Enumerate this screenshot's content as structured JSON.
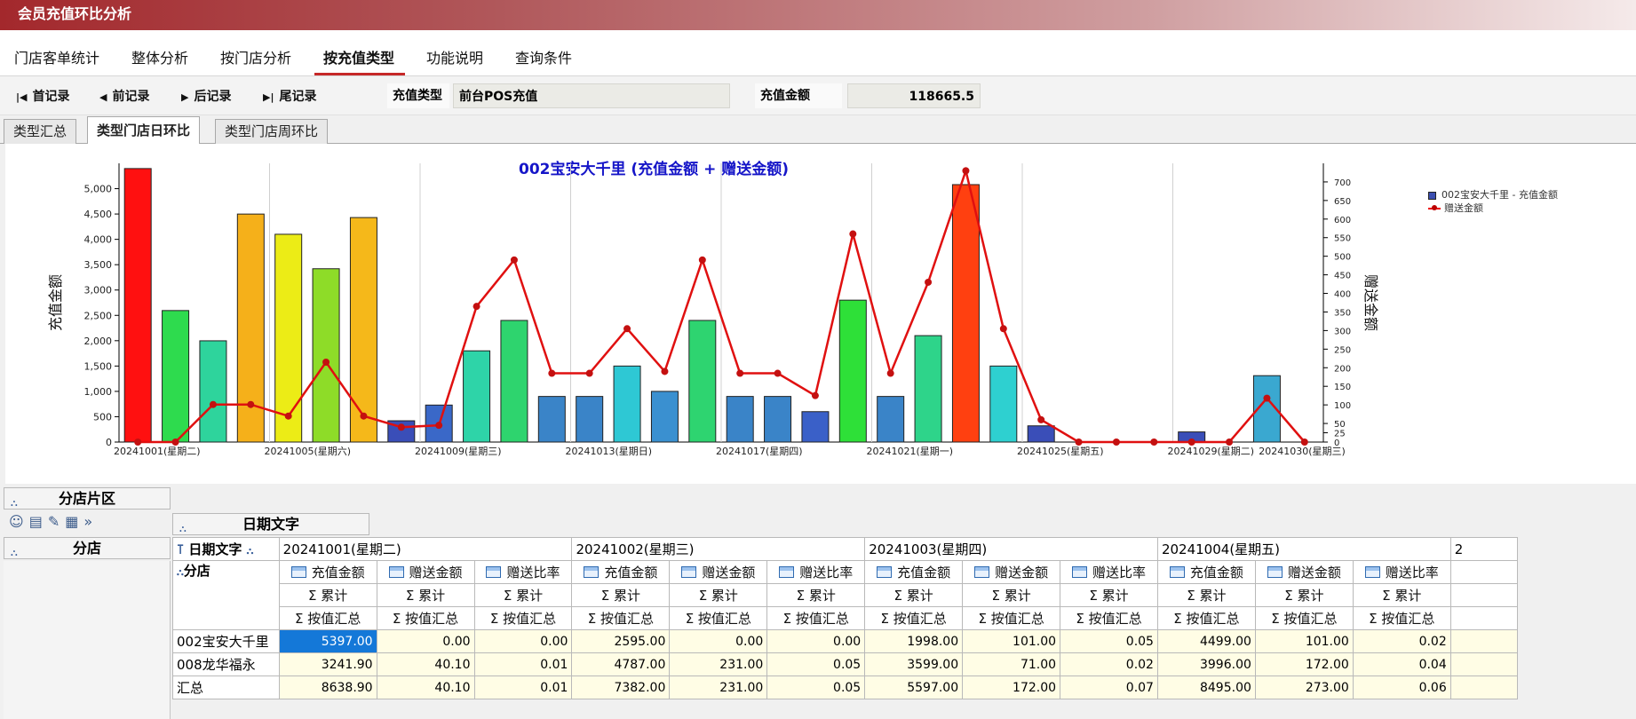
{
  "window": {
    "title": "会员充值环比分析"
  },
  "menu": {
    "items": [
      "门店客单统计",
      "整体分析",
      "按门店分析",
      "按充值类型",
      "功能说明",
      "查询条件"
    ],
    "active_index": 3
  },
  "toolbar": {
    "first": "首记录",
    "prev": "前记录",
    "next": "后记录",
    "last": "尾记录",
    "type_label": "充值类型",
    "type_value": "前台POS充值",
    "amount_label": "充值金额",
    "amount_value": "118665.5"
  },
  "subtabs": {
    "items": [
      "类型汇总",
      "类型门店日环比",
      "类型门店周环比"
    ],
    "active_index": 1
  },
  "chart_data": {
    "type": "bar+line",
    "title": "002宝安大千里 (充值金额 + 赠送金额)",
    "ylabel": "充值金额",
    "y2label": "赠送金额",
    "ylim": [
      0,
      5500
    ],
    "y2lim": [
      0,
      750
    ],
    "yticks": [
      "0",
      "500",
      "1,000",
      "1,500",
      "2,000",
      "2,500",
      "3,000",
      "3,500",
      "4,000",
      "4,500",
      "5,000"
    ],
    "y2ticks": [
      "0",
      "25",
      "50",
      "100",
      "150",
      "200",
      "250",
      "300",
      "350",
      "400",
      "450",
      "500",
      "550",
      "600",
      "650",
      "700"
    ],
    "xticks": [
      "20241001(星期二)",
      "20241005(星期六)",
      "20241009(星期三)",
      "20241013(星期日)",
      "20241017(星期四)",
      "20241021(星期一)",
      "20241025(星期五)",
      "20241029(星期二)",
      "20241030(星期三)"
    ],
    "series": [
      {
        "name": "002宝安大千里 - 充值金额",
        "type": "bar",
        "values": [
          5397,
          2595,
          1998,
          4499,
          4100,
          3420,
          4430,
          420,
          730,
          1800,
          2400,
          900,
          900,
          1500,
          1000,
          2400,
          900,
          900,
          600,
          2800,
          900,
          2100,
          5080,
          1500,
          320,
          0,
          0,
          0,
          200,
          0,
          1310,
          0
        ],
        "colors": [
          "#ff1010",
          "#2edb4e",
          "#2ed49c",
          "#f5b01a",
          "#ecec16",
          "#8edc28",
          "#f5b81a",
          "#3a4eb8",
          "#3a68c8",
          "#2ed4a8",
          "#2ed46e",
          "#3a84c8",
          "#3a84c8",
          "#2ec8d4",
          "#3a90d0",
          "#2ed470",
          "#3a84c8",
          "#3a84c8",
          "#3a60c8",
          "#2ee038",
          "#3a84c8",
          "#2ed48a",
          "#ff4010",
          "#2ed0d0",
          "#3a4eb8",
          "#3a84c8",
          "#3a84c8",
          "#3a84c8",
          "#3a4eb8",
          "#3a84c8",
          "#3aa8d0",
          "#3a84c8"
        ]
      },
      {
        "name": "赠送金额",
        "type": "line",
        "color": "#e01010",
        "values": [
          0,
          0,
          101,
          101,
          70,
          215,
          70,
          40,
          45,
          365,
          490,
          185,
          185,
          305,
          190,
          490,
          185,
          185,
          125,
          560,
          185,
          430,
          730,
          305,
          60,
          0,
          0,
          0,
          0,
          0,
          118,
          0
        ]
      }
    ],
    "legend_position": "top-right",
    "grid": "vertical"
  },
  "pivot": {
    "filter_header": "分店片区",
    "col_header": "日期文字",
    "row_header": "分店",
    "date_field": "日期文字",
    "branch_field": "分店",
    "dates": [
      "20241001(星期二)",
      "20241002(星期三)",
      "20241003(星期四)",
      "20241004(星期五)",
      "2"
    ],
    "measures": [
      "充值金额",
      "赠送金额",
      "赠送比率"
    ],
    "agg1": "Σ 累计",
    "agg2": "Σ 按值汇总",
    "rows": [
      {
        "name": "002宝安大千里",
        "values": [
          "5397.00",
          "0.00",
          "0.00",
          "2595.00",
          "0.00",
          "0.00",
          "1998.00",
          "101.00",
          "0.05",
          "4499.00",
          "101.00",
          "0.02"
        ]
      },
      {
        "name": "008龙华福永",
        "values": [
          "3241.90",
          "40.10",
          "0.01",
          "4787.00",
          "231.00",
          "0.05",
          "3599.00",
          "71.00",
          "0.02",
          "3996.00",
          "172.00",
          "0.04"
        ]
      },
      {
        "name": "汇总",
        "values": [
          "8638.90",
          "40.10",
          "0.01",
          "7382.00",
          "231.00",
          "0.05",
          "5597.00",
          "172.00",
          "0.07",
          "8495.00",
          "273.00",
          "0.06"
        ]
      }
    ]
  }
}
